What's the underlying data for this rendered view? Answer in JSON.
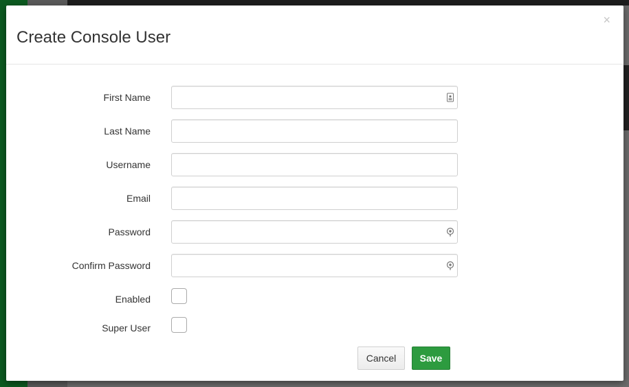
{
  "modal": {
    "title": "Create Console User",
    "close_label": "×"
  },
  "form": {
    "fields": [
      {
        "label": "First Name",
        "value": "",
        "icon": "contact-card-icon"
      },
      {
        "label": "Last Name",
        "value": ""
      },
      {
        "label": "Username",
        "value": ""
      },
      {
        "label": "Email",
        "value": ""
      },
      {
        "label": "Password",
        "value": "",
        "icon": "password-key-icon"
      },
      {
        "label": "Confirm Password",
        "value": "",
        "icon": "password-key-icon"
      }
    ],
    "checkboxes": [
      {
        "label": "Enabled",
        "checked": false
      },
      {
        "label": "Super User",
        "checked": false
      }
    ]
  },
  "actions": {
    "cancel_label": "Cancel",
    "save_label": "Save"
  },
  "colors": {
    "save": "#2d9b3f",
    "sidebar": "#0c5a20"
  }
}
